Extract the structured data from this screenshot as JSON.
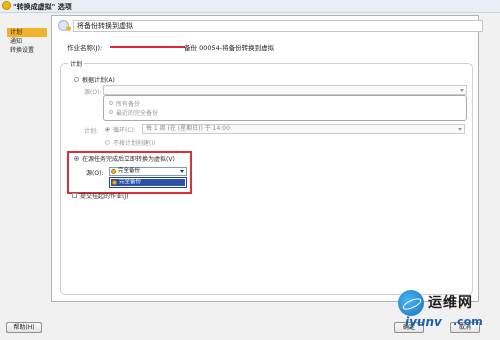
{
  "window": {
    "title": "\"转换成虚拟\" 选项"
  },
  "sidebar": {
    "items": [
      {
        "label": "计划"
      },
      {
        "label": "通知"
      },
      {
        "label": "转换设置"
      }
    ]
  },
  "header": {
    "title": "将备份转换到虚拟"
  },
  "job": {
    "name_label": "作业名称(J):",
    "name_value": "备份 00054-将备份转换到虚拟"
  },
  "plan": {
    "group_label": "计划",
    "by_schedule_label": "根据计划(A)",
    "source_label": "源(O):",
    "source_options": [
      "所有备份",
      "最近的完全备份"
    ],
    "schedule_label": "计划:",
    "recurring_label": "循环(C):",
    "recurring_value": "每 1 周 (在 (星期日)) 于 14:00",
    "no_schedule_label": "不按计划创建(I)",
    "after_backup_label": "在源任务完成后立即转换为虚拟(V)",
    "after_source_label": "源(O):",
    "after_source_value": "完全备份",
    "dropdown_items": [
      "完全备份"
    ],
    "submit_paused_label": "提交挂起的作业(J)"
  },
  "footer": {
    "help_label": "帮助(H)",
    "ok_label": "确定",
    "cancel_label": "取消"
  },
  "watermark": {
    "title": "运维网",
    "url": "iyunv",
    "suffix": ".com"
  },
  "colors": {
    "accent": "#f2b32c",
    "highlight_border": "#d9323a",
    "selection": "#2b51a8"
  }
}
